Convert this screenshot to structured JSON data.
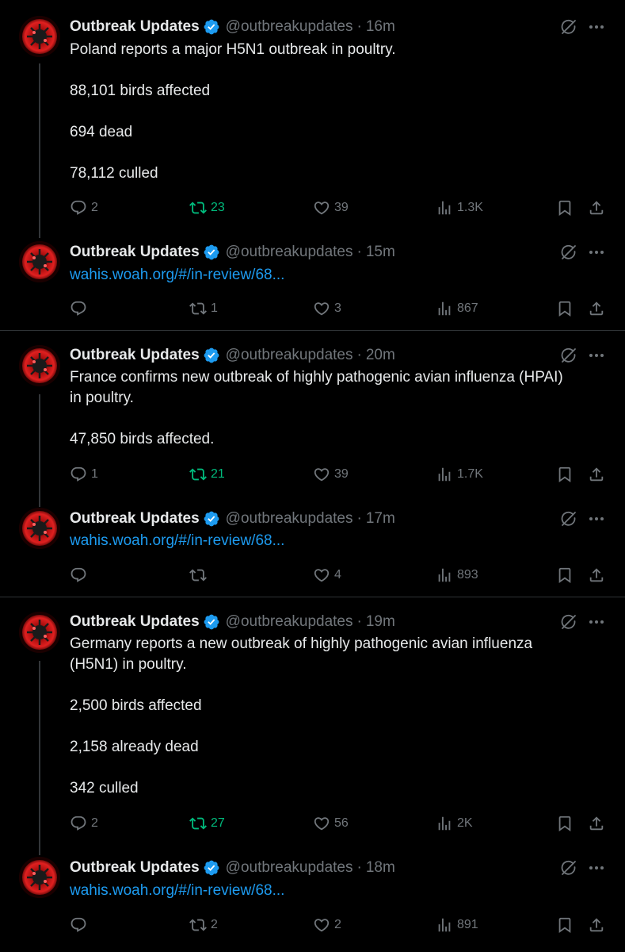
{
  "colors": {
    "background": "#000000",
    "text": "#e7e9ea",
    "muted": "#71767b",
    "link": "#1d9bf0",
    "verified": "#1d9bf0",
    "retweet_active": "#00ba7c",
    "divider": "#2f3336"
  },
  "icons": {
    "verified": "verified-badge-icon",
    "grok": "grok-icon",
    "more": "more-icon",
    "reply": "reply-icon",
    "retweet": "retweet-icon",
    "like": "heart-icon",
    "views": "views-icon",
    "bookmark": "bookmark-icon",
    "share": "share-icon"
  },
  "threads": [
    {
      "tweets": [
        {
          "name": "Outbreak Updates",
          "handle": "@outbreakupdates",
          "separator": "·",
          "time": "16m",
          "lines": [
            "Poland reports a major H5N1 outbreak in poultry.",
            "",
            "88,101 birds affected",
            "",
            "694 dead",
            "",
            "78,112 culled"
          ],
          "link": "",
          "replies": "2",
          "retweets": "23",
          "retweeted": true,
          "likes": "39",
          "views": "1.3K"
        },
        {
          "name": "Outbreak Updates",
          "handle": "@outbreakupdates",
          "separator": "·",
          "time": "15m",
          "lines": [],
          "link": "wahis.woah.org/#/in-review/68...",
          "replies": "",
          "retweets": "1",
          "retweeted": false,
          "likes": "3",
          "views": "867"
        }
      ]
    },
    {
      "tweets": [
        {
          "name": "Outbreak Updates",
          "handle": "@outbreakupdates",
          "separator": "·",
          "time": "20m",
          "lines": [
            "France confirms new outbreak of highly pathogenic avian influenza (HPAI)",
            "in poultry.",
            "",
            "47,850 birds affected."
          ],
          "link": "",
          "replies": "1",
          "retweets": "21",
          "retweeted": true,
          "likes": "39",
          "views": "1.7K"
        },
        {
          "name": "Outbreak Updates",
          "handle": "@outbreakupdates",
          "separator": "·",
          "time": "17m",
          "lines": [],
          "link": "wahis.woah.org/#/in-review/68...",
          "replies": "",
          "retweets": "",
          "retweeted": false,
          "likes": "4",
          "views": "893"
        }
      ]
    },
    {
      "tweets": [
        {
          "name": "Outbreak Updates",
          "handle": "@outbreakupdates",
          "separator": "·",
          "time": "19m",
          "lines": [
            "Germany reports a new outbreak of highly pathogenic avian influenza",
            "(H5N1) in poultry.",
            "",
            "2,500 birds affected",
            "",
            "2,158 already dead",
            "",
            "342 culled"
          ],
          "link": "",
          "replies": "2",
          "retweets": "27",
          "retweeted": true,
          "likes": "56",
          "views": "2K"
        },
        {
          "name": "Outbreak Updates",
          "handle": "@outbreakupdates",
          "separator": "·",
          "time": "18m",
          "lines": [],
          "link": "wahis.woah.org/#/in-review/68...",
          "replies": "",
          "retweets": "2",
          "retweeted": false,
          "likes": "2",
          "views": "891"
        }
      ]
    }
  ]
}
